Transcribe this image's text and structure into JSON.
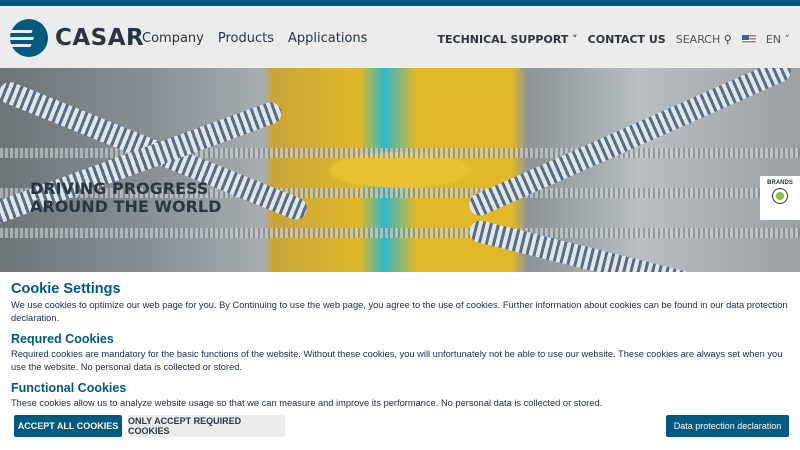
{
  "brand": {
    "name": "CASAR",
    "color": "#005a7f"
  },
  "nav": {
    "items": [
      "Company",
      "Products",
      "Applications"
    ]
  },
  "right_nav": {
    "technical_support": "TECHNICAL SUPPORT",
    "contact_us": "CONTACT US",
    "search": "SEARCH",
    "language": "EN"
  },
  "hero": {
    "title_line1": "DRIVING PROGRESS",
    "title_line2": "AROUND THE WORLD",
    "brands_label": "BRANDS"
  },
  "cookie": {
    "title": "Cookie Settings",
    "intro": "We use cookies to optimize our web page for you. By Continuing to use the web page, you agree to the use of cookies. Further information about cookies can be found in our data protection declaration.",
    "required_title": "Requred Cookies",
    "required_text": "Required cookies are mandatory for the basic functions of the website. Without these cookies, you will unfortunately not be able to use our website. These cookies are always set when you use the website. No personal data is collected or stored.",
    "functional_title": "Functional Cookies",
    "functional_text": "These cookies allow us to analyze website usage so that we can measure and improve its performance. No personal data is collected or stored.",
    "accept_all": "ACCEPT ALL COOKIES",
    "accept_required": "ONLY ACCEPT REQUIRED COOKIES",
    "data_protection": "Data protection declaration"
  }
}
